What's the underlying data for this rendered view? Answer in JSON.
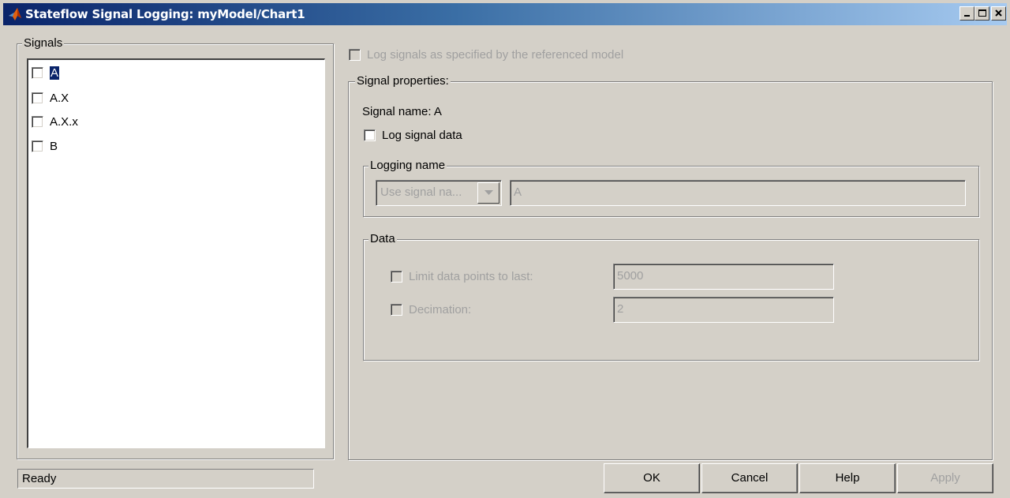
{
  "window": {
    "title": "Stateflow Signal Logging: myModel/Chart1",
    "minimize_icon": "minimize-icon",
    "maximize_icon": "maximize-icon",
    "close_icon": "close-icon"
  },
  "signals": {
    "group_label": "Signals",
    "items": [
      {
        "label": "A",
        "checked": false,
        "selected": true
      },
      {
        "label": "A.X",
        "checked": false,
        "selected": false
      },
      {
        "label": "A.X.x",
        "checked": false,
        "selected": false
      },
      {
        "label": "B",
        "checked": false,
        "selected": false
      }
    ]
  },
  "log_referenced": {
    "label": "Log signals as specified by the referenced model",
    "checked": false,
    "enabled": false
  },
  "signal_properties": {
    "group_label": "Signal properties:",
    "signal_name_text": "Signal name: A",
    "log_signal_data_label": "Log signal data",
    "log_signal_data_checked": false,
    "logging_name": {
      "group_label": "Logging name",
      "combo_value": "Use signal na...",
      "name_value": "A"
    },
    "data": {
      "group_label": "Data",
      "limit_label": "Limit data points to last:",
      "limit_value": "5000",
      "decimation_label": "Decimation:",
      "decimation_value": "2"
    }
  },
  "status": {
    "text": "Ready"
  },
  "buttons": {
    "ok": "OK",
    "cancel": "Cancel",
    "help": "Help",
    "apply": "Apply"
  }
}
